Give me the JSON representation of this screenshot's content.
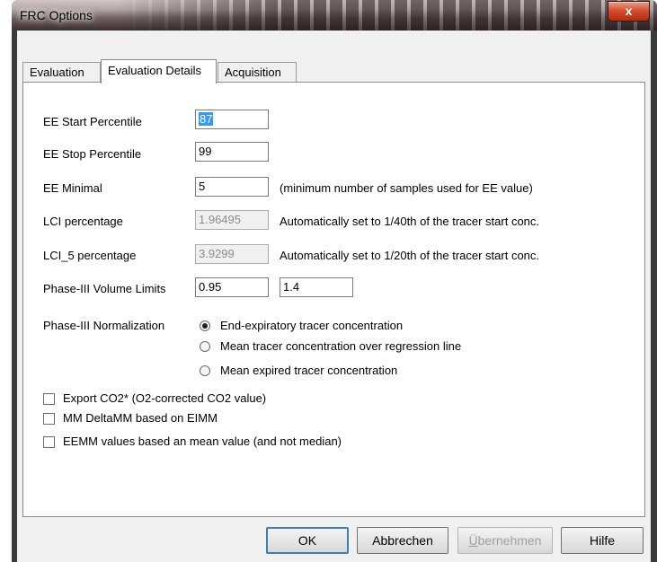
{
  "window": {
    "title": "FRC Options",
    "close_glyph": "x"
  },
  "tabs": [
    {
      "label": "Evaluation"
    },
    {
      "label": "Evaluation Details"
    },
    {
      "label": "Acquisition"
    }
  ],
  "fields": {
    "ee_start": {
      "label": "EE Start Percentile",
      "value": "87"
    },
    "ee_stop": {
      "label": "EE Stop Percentile",
      "value": "99"
    },
    "ee_minimal": {
      "label": "EE Minimal",
      "value": "5",
      "note": "(minimum number of samples used for EE value)"
    },
    "lci": {
      "label": "LCI percentage",
      "value": "1.96495",
      "note": "Automatically set to 1/40th of the tracer start conc."
    },
    "lci5": {
      "label": "LCI_5 percentage",
      "value": "3.9299",
      "note": "Automatically set to 1/20th of the tracer start conc."
    },
    "phase3_limits": {
      "label": "Phase-III Volume Limits",
      "value_low": "0.95",
      "value_high": "1.4"
    }
  },
  "normalization": {
    "label": "Phase-III Normalization",
    "options": [
      {
        "label": "End-expiratory tracer concentration",
        "selected": true
      },
      {
        "label": "Mean tracer concentration over regression line",
        "selected": false
      },
      {
        "label": "Mean expired tracer concentration",
        "selected": false
      }
    ]
  },
  "checkboxes": [
    {
      "label": "Export CO2* (O2-corrected CO2 value)",
      "checked": false
    },
    {
      "label": "MM DeltaMM based on EIMM",
      "checked": false
    },
    {
      "label": "EEMM values based an mean value (and not median)",
      "checked": false
    }
  ],
  "buttons": {
    "ok": "OK",
    "cancel": "Abbrechen",
    "apply_first": "Ü",
    "apply_rest": "bernehmen",
    "help": "Hilfe"
  }
}
